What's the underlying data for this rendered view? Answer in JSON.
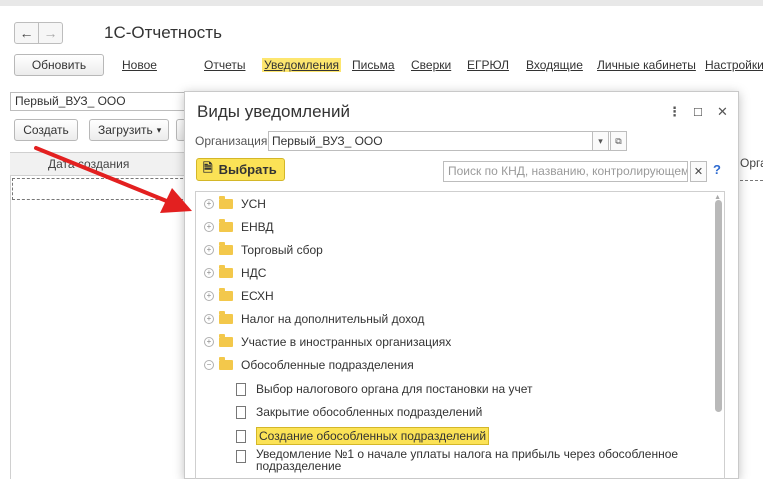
{
  "app": {
    "title": "1С-Отчетность"
  },
  "toolbar": {
    "refresh": "Обновить",
    "new": "Новое",
    "links": [
      "Отчеты",
      "Уведомления",
      "Письма",
      "Сверки",
      "ЕГРЮЛ",
      "Входящие",
      "Личные кабинеты",
      "Настройки"
    ],
    "active_link": "Уведомления"
  },
  "org_value": "Первый_ВУЗ_ ООО",
  "actions": {
    "create": "Создать",
    "load": "Загрузить"
  },
  "list": {
    "date_col": "Дата создания",
    "right_col": "Орган"
  },
  "dialog": {
    "title": "Виды уведомлений",
    "org_label": "Организация:",
    "org_value": "Первый_ВУЗ_ ООО",
    "select_button": "Выбрать",
    "search_placeholder": "Поиск по КНД, названию, контролирующему о...",
    "help": "?",
    "tree": [
      {
        "label": "УСН",
        "type": "folder",
        "state": "collapsed"
      },
      {
        "label": "ЕНВД",
        "type": "folder",
        "state": "collapsed"
      },
      {
        "label": "Торговый сбор",
        "type": "folder",
        "state": "collapsed"
      },
      {
        "label": "НДС",
        "type": "folder",
        "state": "collapsed"
      },
      {
        "label": "ЕСХН",
        "type": "folder",
        "state": "collapsed"
      },
      {
        "label": "Налог на дополнительный доход",
        "type": "folder",
        "state": "collapsed"
      },
      {
        "label": "Участие в иностранных организациях",
        "type": "folder",
        "state": "collapsed"
      },
      {
        "label": "Обособленные подразделения",
        "type": "folder",
        "state": "expanded"
      },
      {
        "label": "Выбор налогового органа для постановки на учет",
        "type": "doc"
      },
      {
        "label": "Закрытие обособленных подразделений",
        "type": "doc"
      },
      {
        "label": "Создание обособленных подразделений",
        "type": "doc",
        "selected": true
      },
      {
        "label": "Уведомление №1 о начале уплаты налога на прибыль через обособленное",
        "label2": "подразделение",
        "type": "doc"
      }
    ]
  },
  "colors": {
    "accent": "#fbe256",
    "arrow": "#e32020"
  }
}
